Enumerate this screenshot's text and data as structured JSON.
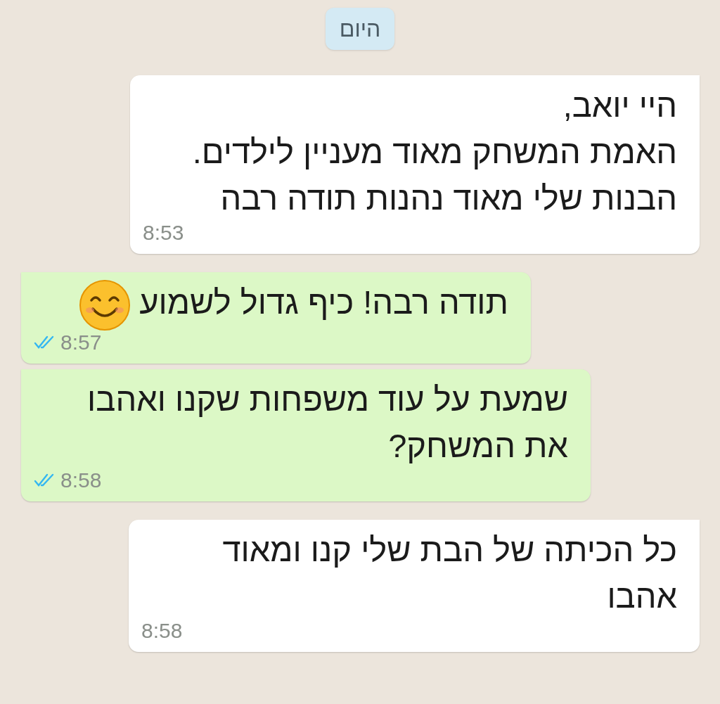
{
  "date_divider": "היום",
  "messages": [
    {
      "kind": "incoming",
      "text": "היי יואב,\nהאמת המשחק מאוד מעניין לילדים.\nהבנות שלי מאוד נהנות תודה רבה",
      "time": "8:53"
    },
    {
      "kind": "outgoing",
      "text": "תודה רבה! כיף גדול לשמוע",
      "attachment": {
        "kind": "smile"
      },
      "time": "8:57",
      "read": true
    },
    {
      "kind": "outgoing",
      "text": "שמעת על עוד משפחות שקנו ואהבו\nאת המשחק?",
      "time": "8:58",
      "read": true
    },
    {
      "kind": "incoming",
      "text": "כל הכיתה של הבת שלי קנו ומאוד\nאהבו",
      "time": "8:58"
    }
  ]
}
